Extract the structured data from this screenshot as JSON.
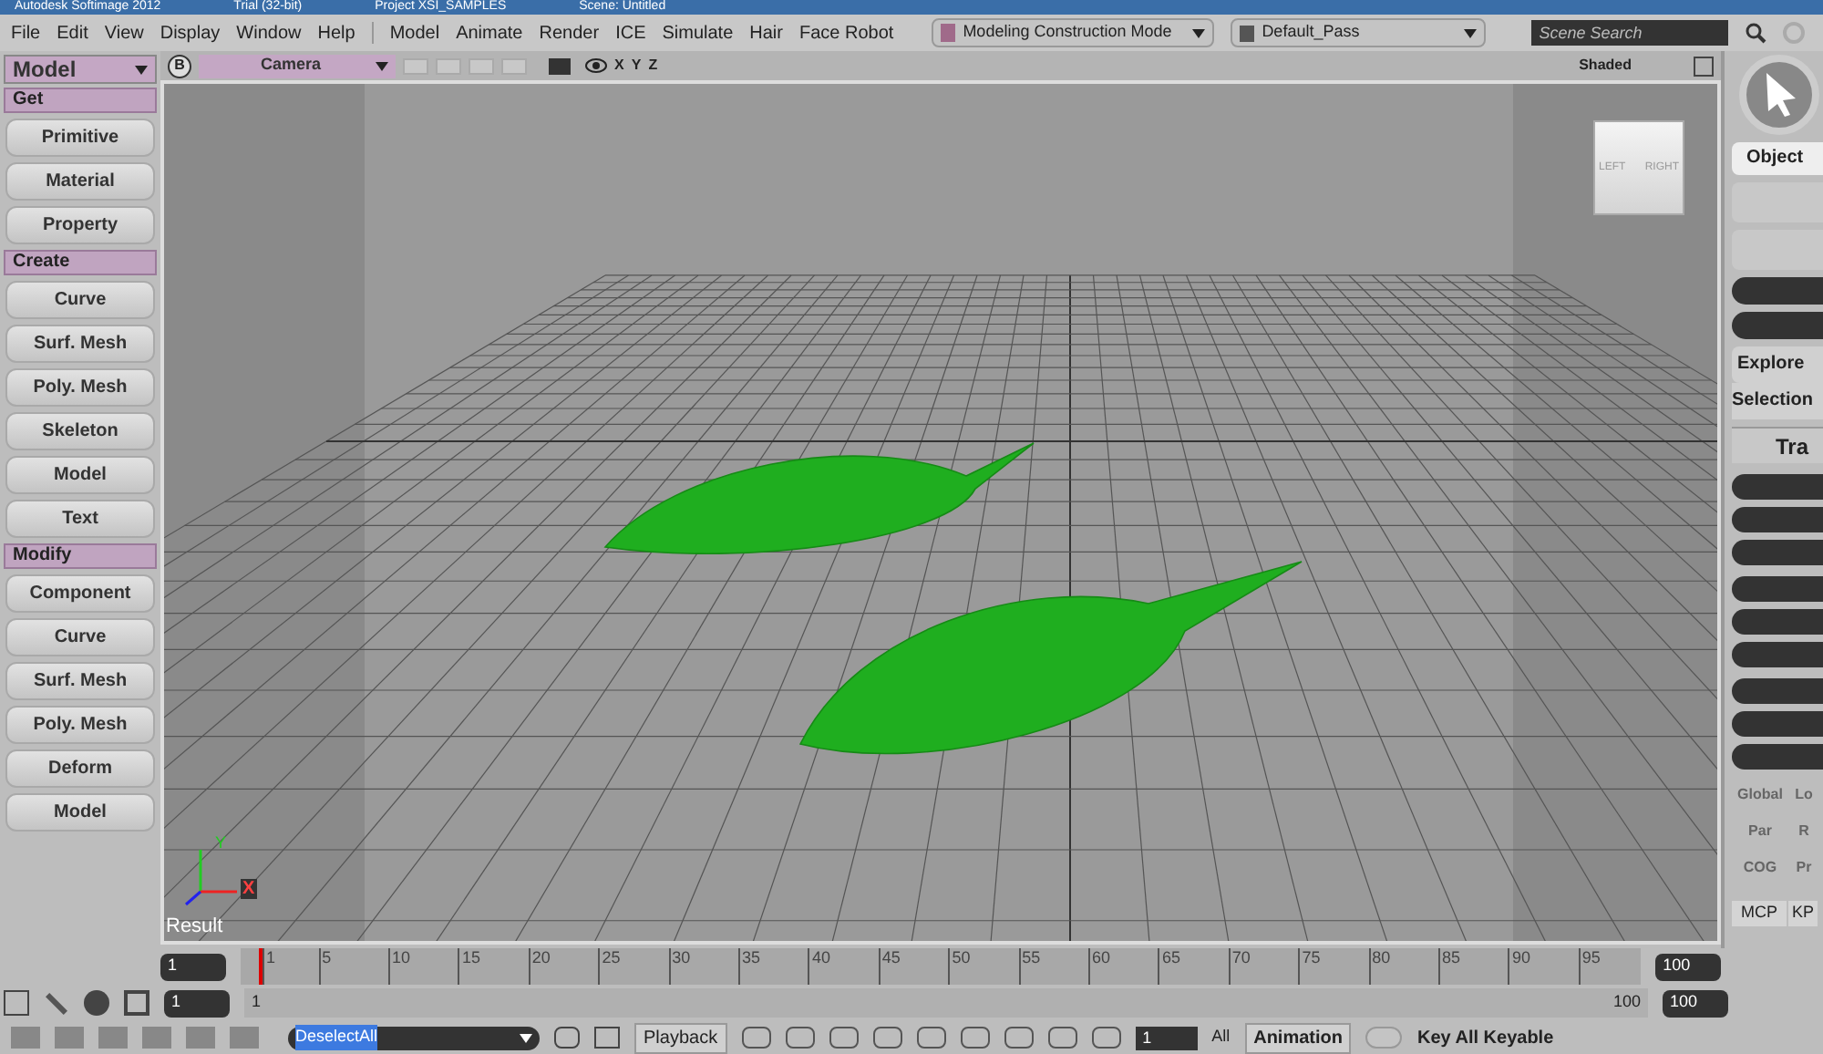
{
  "title_bar": [
    "Autodesk Softimage 2012",
    "Trial (32-bit)",
    "Project XSI_SAMPLES",
    "Scene: Untitled"
  ],
  "menu_left": [
    "File",
    "Edit",
    "View",
    "Display",
    "Window",
    "Help"
  ],
  "menu_right": [
    "Model",
    "Animate",
    "Render",
    "ICE",
    "Simulate",
    "Hair",
    "Face Robot"
  ],
  "mode_dropdown": "Modeling Construction Mode",
  "pass_dropdown": "Default_Pass",
  "scene_search": {
    "placeholder": "Scene Search"
  },
  "panel_dropdown": "Model",
  "sections": [
    {
      "title": "Get",
      "buttons": [
        "Primitive",
        "Material",
        "Property"
      ]
    },
    {
      "title": "Create",
      "buttons": [
        "Curve",
        "Surf. Mesh",
        "Poly. Mesh",
        "Skeleton",
        "Model",
        "Text"
      ]
    },
    {
      "title": "Modify",
      "buttons": [
        "Component",
        "Curve",
        "Surf. Mesh",
        "Poly. Mesh",
        "Deform",
        "Model"
      ]
    }
  ],
  "viewport": {
    "badge": "B",
    "camera": "Camera",
    "axes": [
      "X",
      "Y",
      "Z"
    ],
    "shading": "Shaded",
    "cube_labels": [
      "LEFT",
      "RIGHT"
    ],
    "axis_labels": [
      "Y",
      "X"
    ],
    "result": "Result"
  },
  "right_panel": {
    "object": "Object",
    "explore": "Explore",
    "selection": "Selection",
    "transform": "Tra",
    "row1": [
      "Global",
      "Lo"
    ],
    "row2": [
      "Par",
      "R"
    ],
    "row3": [
      "COG",
      "Pr"
    ],
    "tabs": [
      "MCP",
      "KP"
    ]
  },
  "timeline": {
    "start": "1",
    "range_start": "1",
    "ticks": [
      "1",
      "5",
      "10",
      "15",
      "20",
      "25",
      "30",
      "35",
      "40",
      "45",
      "50",
      "55",
      "60",
      "65",
      "70",
      "75",
      "80",
      "85",
      "90",
      "95"
    ],
    "range_end": "100",
    "end": "100",
    "end2": "100",
    "range_label": "1"
  },
  "bottom": {
    "select": "DeselectAll",
    "playback": "Playback",
    "frame": "1",
    "all": "All",
    "animation": "Animation",
    "key": "Key All Keyable",
    "key_toggle_on": false
  }
}
